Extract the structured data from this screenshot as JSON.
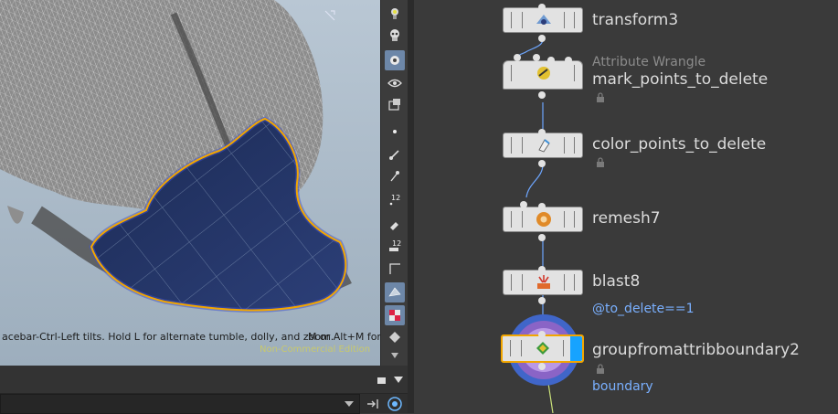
{
  "viewport": {
    "hint": "acebar-Ctrl-Left tilts. Hold L for alternate tumble, dolly, and zoom.",
    "hint_right": "M or Alt+M for",
    "edition": "Non-Commercial Edition"
  },
  "toolbar": {
    "icons": [
      "light-bulb-icon",
      "skull-light-icon",
      "display-options-icon",
      "eye-visibility-icon",
      "snapshot-icon",
      "point-icon",
      "edge-brush-icon",
      "pen-icon",
      "numbers-12-icon",
      "paint-icon",
      "numbers-12-icon",
      "frame-icon",
      "wireframe-icon",
      "checker-icon",
      "shaded-icon",
      "scroll-down-icon"
    ]
  },
  "network": {
    "nodes": [
      {
        "name": "transform3",
        "type": "",
        "sub": ""
      },
      {
        "name": "mark_points_to_delete",
        "type": "Attribute Wrangle",
        "sub": ""
      },
      {
        "name": "color_points_to_delete",
        "type": "",
        "sub": ""
      },
      {
        "name": "remesh7",
        "type": "",
        "sub": ""
      },
      {
        "name": "blast8",
        "type": "",
        "sub": "@to_delete==1"
      },
      {
        "name": "groupfromattribboundary2",
        "type": "",
        "sub": "boundary"
      }
    ]
  },
  "colors": {
    "selection_outline": "#f2a600",
    "display_flag": "#17a3ff",
    "template_ring": "#9b7fd9",
    "node_label": "#dcdcdc",
    "parm_text": "#7ab0ff"
  }
}
